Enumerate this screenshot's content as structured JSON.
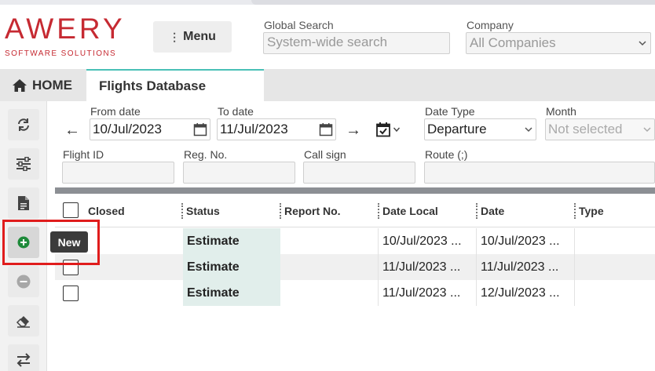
{
  "header": {
    "logo_text": "AWERY",
    "logo_tagline": "SOFTWARE SOLUTIONS",
    "menu_label": "Menu",
    "global_search_label": "Global Search",
    "global_search_placeholder": "System-wide search",
    "company_label": "Company",
    "company_value": "All Companies"
  },
  "tabs": {
    "home": "HOME",
    "active": "Flights Database"
  },
  "toolbar": {
    "tooltip": "New",
    "items": [
      "refresh-icon",
      "filter-sliders-icon",
      "document-icon",
      "add-icon",
      "remove-icon",
      "eraser-icon",
      "swap-icon"
    ]
  },
  "filters": {
    "from_date_label": "From date",
    "from_date_value": "10/Jul/2023",
    "to_date_label": "To date",
    "to_date_value": "11/Jul/2023",
    "date_type_label": "Date Type",
    "date_type_value": "Departure",
    "month_label": "Month",
    "month_value": "Not selected",
    "flight_id_label": "Flight ID",
    "reg_no_label": "Reg. No.",
    "call_sign_label": "Call sign",
    "route_label": "Route (;)"
  },
  "grid": {
    "columns": [
      "Closed",
      "Status",
      "Report No.",
      "Date Local",
      "Date",
      "Type"
    ],
    "rows": [
      {
        "closed": false,
        "status": "Estimate",
        "report_no": "",
        "date_local": "10/Jul/2023 ...",
        "date": "10/Jul/2023 ...",
        "type": ""
      },
      {
        "closed": false,
        "status": "Estimate",
        "report_no": "",
        "date_local": "11/Jul/2023 ...",
        "date": "11/Jul/2023 ...",
        "type": ""
      },
      {
        "closed": false,
        "status": "Estimate",
        "report_no": "",
        "date_local": "11/Jul/2023 ...",
        "date": "12/Jul/2023 ...",
        "type": ""
      }
    ]
  },
  "colors": {
    "brand": "#c62a32",
    "tab_accent": "#49c0b6",
    "status_bg": "#e1eeeb",
    "add_green": "#1e8a3a",
    "highlight_red": "#e01c1c"
  }
}
